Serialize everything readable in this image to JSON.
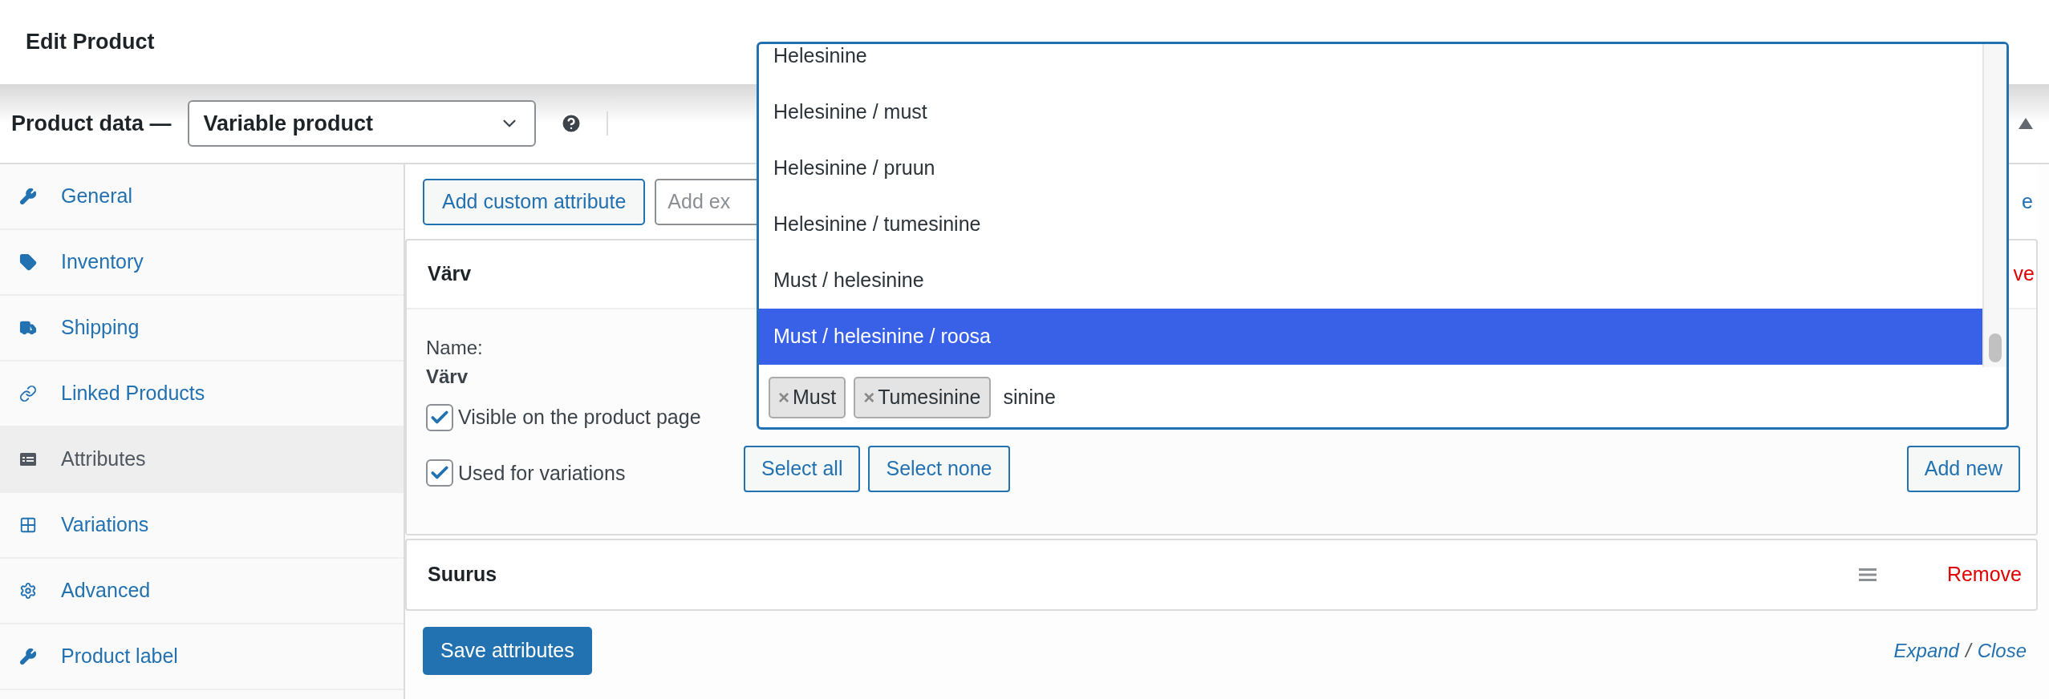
{
  "header": {
    "title": "Edit Product"
  },
  "product_data": {
    "label": "Product data —",
    "type_select": "Variable product"
  },
  "tabs": [
    {
      "label": "General",
      "selected": false
    },
    {
      "label": "Inventory",
      "selected": false
    },
    {
      "label": "Shipping",
      "selected": false
    },
    {
      "label": "Linked Products",
      "selected": false
    },
    {
      "label": "Attributes",
      "selected": true
    },
    {
      "label": "Variations",
      "selected": false
    },
    {
      "label": "Advanced",
      "selected": false
    },
    {
      "label": "Product label",
      "selected": false
    }
  ],
  "toolbar": {
    "add_custom_button": "Add custom attribute",
    "add_existing_placeholder": "Add ex",
    "link_fragment": "e"
  },
  "attributes": [
    {
      "name": "Värv",
      "expanded": true,
      "remove": "ve",
      "name_label": "Name:",
      "name_value": "Värv",
      "checkboxes": [
        {
          "label": "Visible on the product page",
          "checked": true
        },
        {
          "label": "Used for variations",
          "checked": true
        }
      ],
      "buttons": [
        "Select all",
        "Select none"
      ],
      "add_new": "Add new"
    },
    {
      "name": "Suurus",
      "expanded": false,
      "remove": "Remove"
    }
  ],
  "save_button": "Save attributes",
  "expand_close": {
    "expand": "Expand",
    "separator": "/",
    "close": "Close"
  },
  "dropdown": {
    "options": [
      {
        "label": "Helesinine",
        "selected": false
      },
      {
        "label": "Helesinine / must",
        "selected": false
      },
      {
        "label": "Helesinine / pruun",
        "selected": false
      },
      {
        "label": "Helesinine / tumesinine",
        "selected": false
      },
      {
        "label": "Must / helesinine",
        "selected": false
      },
      {
        "label": "Must / helesinine / roosa",
        "selected": true
      }
    ],
    "tags": [
      {
        "label": "Must",
        "remove_glyph": "×"
      },
      {
        "label": "Tumesinine",
        "remove_glyph": "×"
      }
    ],
    "search_value": "sinine"
  }
}
